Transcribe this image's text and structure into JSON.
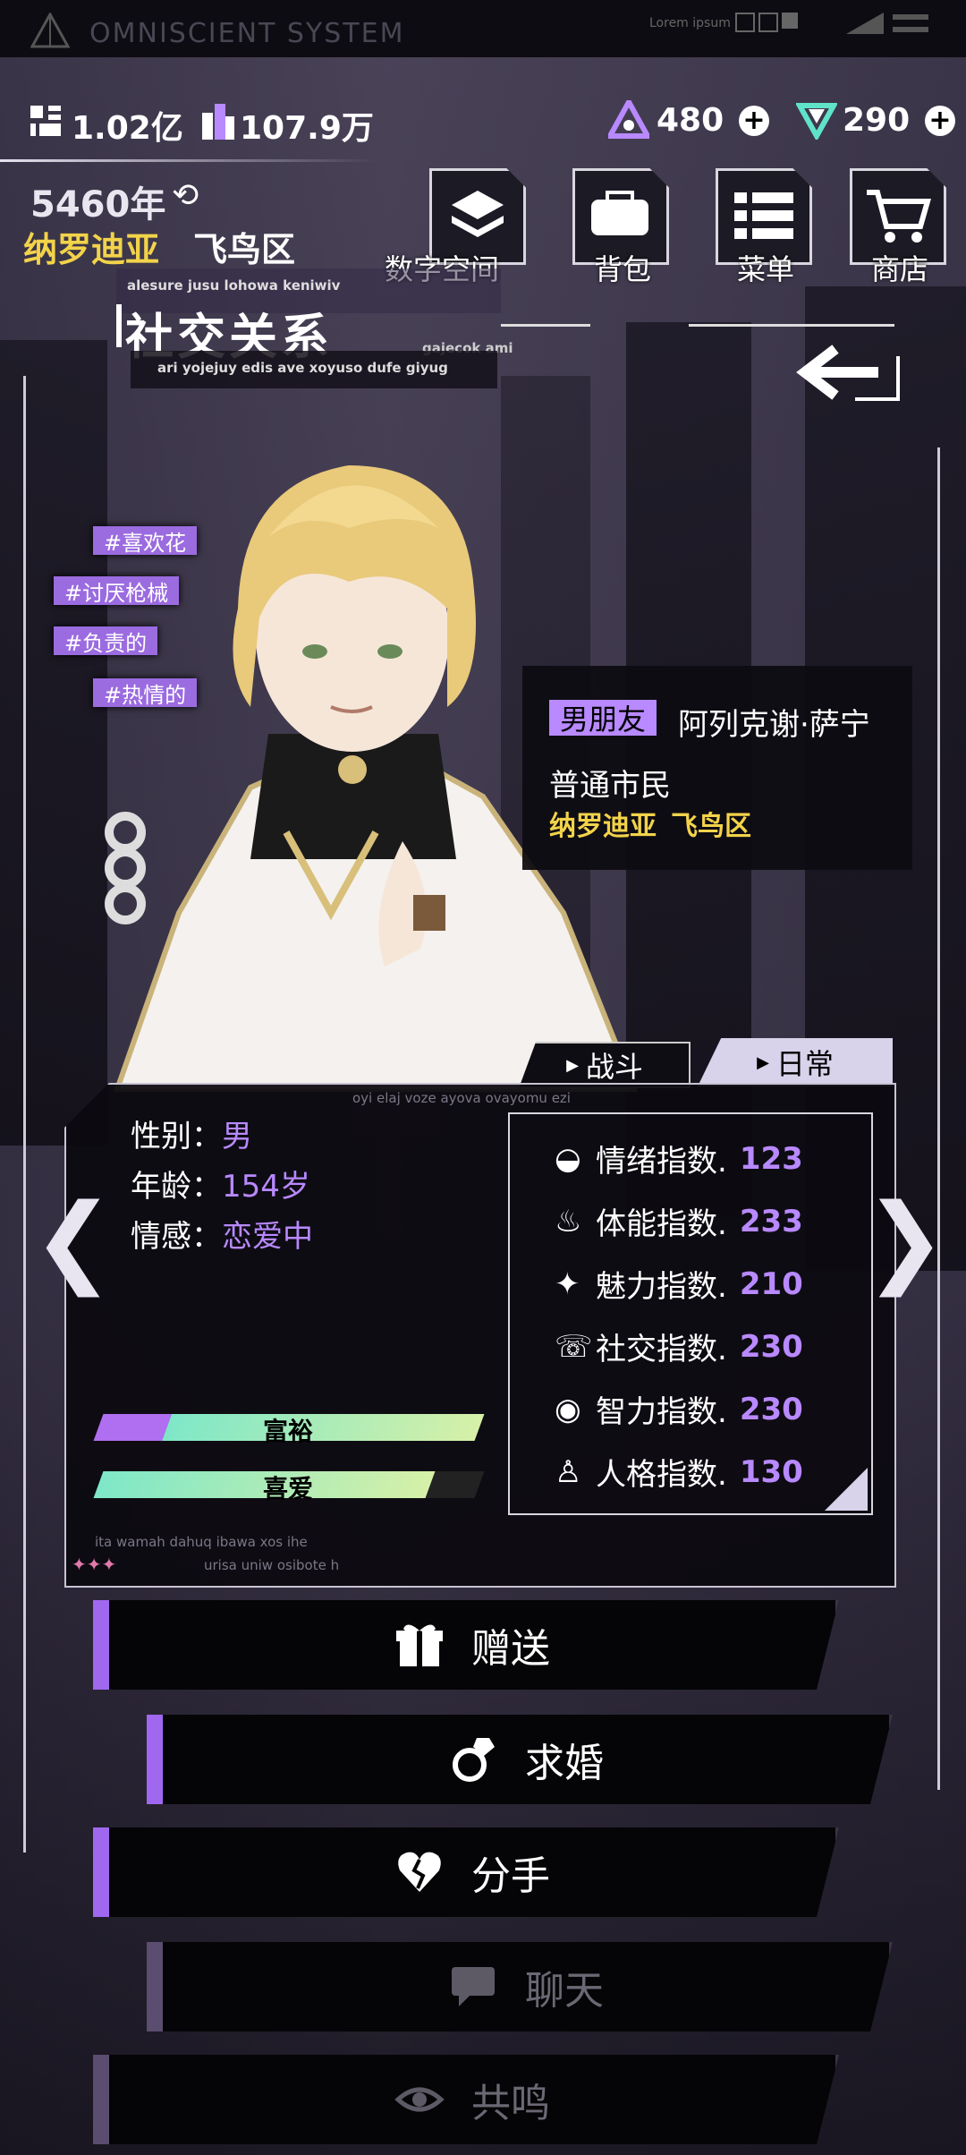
{
  "system": {
    "title": "OMNISCIENT SYSTEM",
    "corner_text": "Lorem ipsum"
  },
  "resources": {
    "gold": "1.02亿",
    "crystals": "107.9万",
    "energy": "480",
    "gems": "290"
  },
  "location": {
    "year": "5460年",
    "city": "纳罗迪亚",
    "district": "飞鸟区"
  },
  "menu": {
    "digital_space": "数字空间",
    "backpack": "背包",
    "menu": "菜单",
    "shop": "商店"
  },
  "header": {
    "title": "社交关系",
    "deco_top": "alesure jusu lohowa keniwiv",
    "deco_right": "gajecok ami",
    "deco_sub": "ari yojejuy edis ave xoyuso dufe giyug"
  },
  "tags": [
    "#喜欢花",
    "#讨厌枪械",
    "#负责的",
    "#热情的"
  ],
  "character": {
    "relation": "男朋友",
    "name": "阿列克谢·萨宁",
    "occupation": "普通市民",
    "home_city": "纳罗迪亚",
    "home_district": "飞鸟区"
  },
  "tabs": {
    "battle": "战斗",
    "daily": "日常",
    "active": "daily"
  },
  "profile": {
    "deco_top": "oyi elaj voze ayova ovayomu ezi",
    "gender_label": "性别：",
    "gender": "男",
    "age_label": "年龄：",
    "age": "154岁",
    "emotion_label": "情感：",
    "emotion": "恋爱中",
    "deco_bottom1": "ita wamah dahuq ibawa xos ihe",
    "deco_bottom2": "urisa uniw osibote h"
  },
  "bars": [
    {
      "label": "富裕",
      "fill_fraction": 1.0
    },
    {
      "label": "喜爱",
      "fill_fraction": 0.87
    }
  ],
  "stats": [
    {
      "label": "情绪指数.",
      "value": "123",
      "icon": "mood-icon"
    },
    {
      "label": "体能指数.",
      "value": "233",
      "icon": "stamina-icon"
    },
    {
      "label": "魅力指数.",
      "value": "210",
      "icon": "charm-icon"
    },
    {
      "label": "社交指数.",
      "value": "230",
      "icon": "social-icon"
    },
    {
      "label": "智力指数.",
      "value": "230",
      "icon": "intellect-icon"
    },
    {
      "label": "人格指数.",
      "value": "130",
      "icon": "personality-icon"
    }
  ],
  "actions": {
    "gift": "赠送",
    "propose": "求婚",
    "breakup": "分手",
    "chat": "聊天",
    "resonate": "共鸣"
  },
  "colors": {
    "accent": "#a068ef",
    "value": "#b889ff",
    "location": "#f2d34a"
  }
}
